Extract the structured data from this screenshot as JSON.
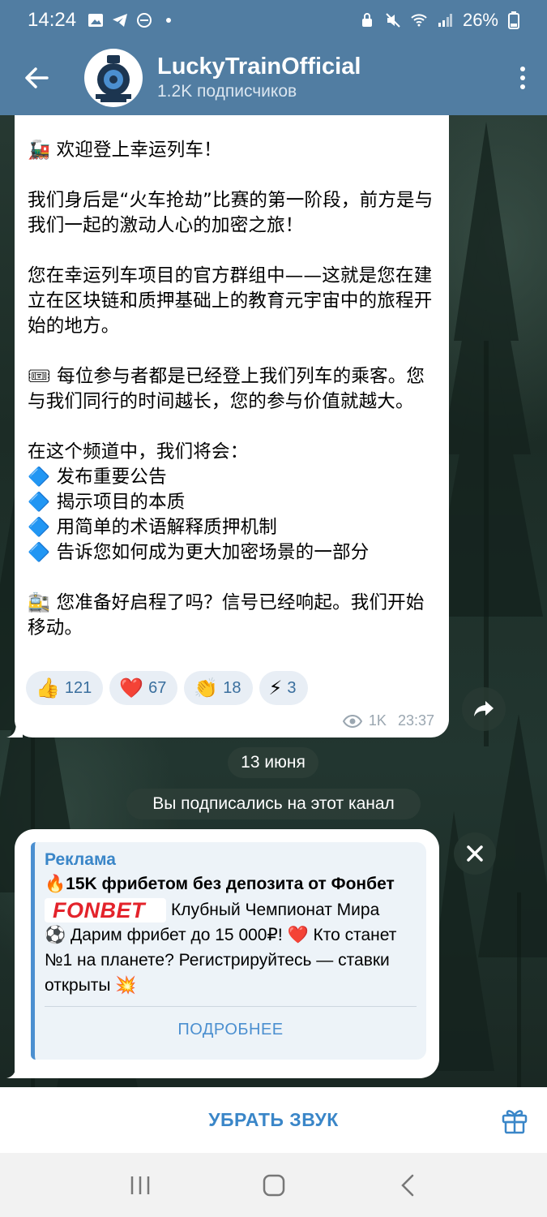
{
  "status_bar": {
    "time": "14:24",
    "battery": "26%"
  },
  "header": {
    "channel_name": "LuckyTrainOfficial",
    "subscribers": "1.2K подписчиков"
  },
  "message": {
    "text": "🚂 欢迎登上幸运列车！\n\n我们身后是“火车抢劫”比赛的第一阶段，前方是与我们一起的激动人心的加密之旅！\n\n您在幸运列车项目的官方群组中——这就是您在建立在区块链和质押基础上的教育元宇宙中的旅程开始的地方。\n\n🎟 每位参与者都是已经登上我们列车的乘客。您与我们同行的时间越长，您的参与价值就越大。\n\n在这个频道中，我们将会：\n🔷 发布重要公告\n🔷 揭示项目的本质\n🔷 用简单的术语解释质押机制\n🔷 告诉您如何成为更大加密场景的一部分\n\n🚉 您准备好启程了吗？信号已经响起。我们开始移动。",
    "reactions": [
      {
        "emoji": "👍",
        "count": "121"
      },
      {
        "emoji": "❤️",
        "count": "67"
      },
      {
        "emoji": "👏",
        "count": "18"
      },
      {
        "emoji": "⚡",
        "count": "3"
      }
    ],
    "views": "1K",
    "time": "23:37"
  },
  "date_label": "13 июня",
  "service_message": "Вы подписались на этот канал",
  "ad": {
    "label": "Реклама",
    "title": "🔥15K фрибетом без депозита от Фонбет",
    "logo_text": "FONBET",
    "body_1": "Клубный Чемпионат Мира",
    "body_2": "⚽ Дарим фрибет до 15 000₽! ❤️ Кто станет №1 на планете? Регистрируйтесь — ставки открыты 💥",
    "more_button": "ПОДРОБНЕЕ"
  },
  "bottom_bar": {
    "mute_label": "УБРАТЬ ЗВУК"
  },
  "colors": {
    "header": "#517da2",
    "accent": "#3a86c8",
    "reaction_bg": "#e8eef5"
  }
}
